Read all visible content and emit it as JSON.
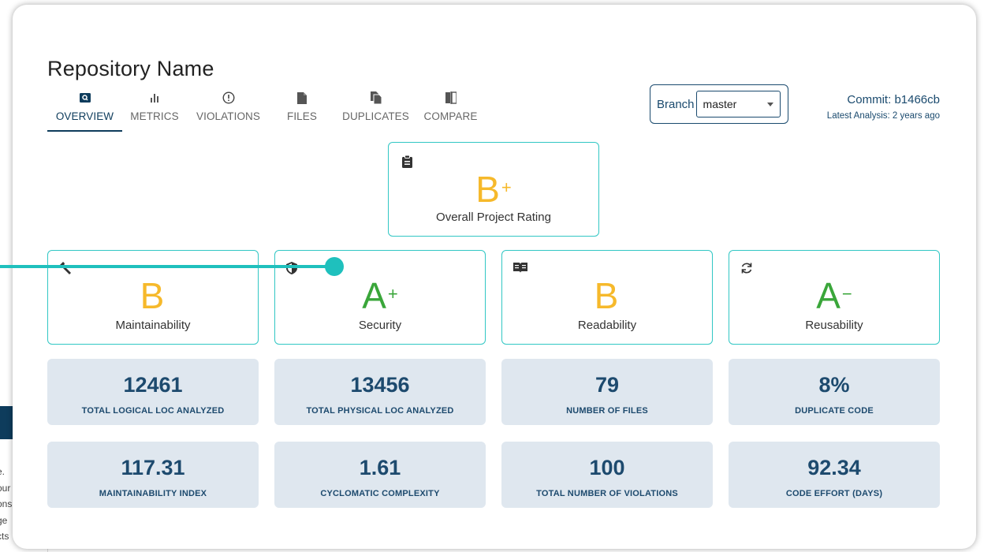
{
  "repo": {
    "title": "Repository Name"
  },
  "tabs": [
    {
      "label": "OVERVIEW",
      "icon": "search-icon",
      "active": true
    },
    {
      "label": "METRICS",
      "icon": "bar-chart-icon",
      "active": false
    },
    {
      "label": "VIOLATIONS",
      "icon": "alert-circle-icon",
      "active": false
    },
    {
      "label": "FILES",
      "icon": "file-icon",
      "active": false
    },
    {
      "label": "DUPLICATES",
      "icon": "copy-icon",
      "active": false
    },
    {
      "label": "COMPARE",
      "icon": "compare-icon",
      "active": false
    }
  ],
  "branch": {
    "label": "Branch",
    "value": "master"
  },
  "commit": {
    "label": "Commit:",
    "hash": "b1466cb",
    "analysis": "Latest Analysis: 2 years ago"
  },
  "overall": {
    "letter": "B",
    "modifier": "+",
    "label": "Overall Project Rating",
    "color": "#f6b92b",
    "icon": "clipboard-icon"
  },
  "ratings": [
    {
      "letter": "B",
      "modifier": "",
      "label": "Maintainability",
      "color": "#f6b92b",
      "icon": "wrench-icon"
    },
    {
      "letter": "A",
      "modifier": "+",
      "label": "Security",
      "color": "#3aa63a",
      "icon": "shield-icon"
    },
    {
      "letter": "B",
      "modifier": "",
      "label": "Readability",
      "color": "#f6b92b",
      "icon": "book-icon"
    },
    {
      "letter": "A",
      "modifier": "−",
      "label": "Reusability",
      "color": "#3aa63a",
      "icon": "refresh-icon"
    }
  ],
  "metrics": [
    {
      "value": "12461",
      "label": "TOTAL LOGICAL LOC ANALYZED"
    },
    {
      "value": "13456",
      "label": "TOTAL PHYSICAL LOC ANALYZED"
    },
    {
      "value": "79",
      "label": "NUMBER OF FILES"
    },
    {
      "value": "8%",
      "label": "DUPLICATE CODE"
    },
    {
      "value": "117.31",
      "label": "MAINTAINABILITY INDEX"
    },
    {
      "value": "1.61",
      "label": "CYCLOMATIC COMPLEXITY"
    },
    {
      "value": "100",
      "label": "TOTAL NUMBER OF VIOLATIONS"
    },
    {
      "value": "92.34",
      "label": "CODE EFFORT (DAYS)"
    }
  ],
  "background_panel": {
    "lines": [
      "e.",
      "our",
      "ons",
      "ge",
      "cts"
    ]
  },
  "colors": {
    "accent": "#1fc0bd",
    "navy": "#0e3c5c",
    "card_border": "#31c7c4",
    "metric_bg": "#dfe7ef"
  }
}
